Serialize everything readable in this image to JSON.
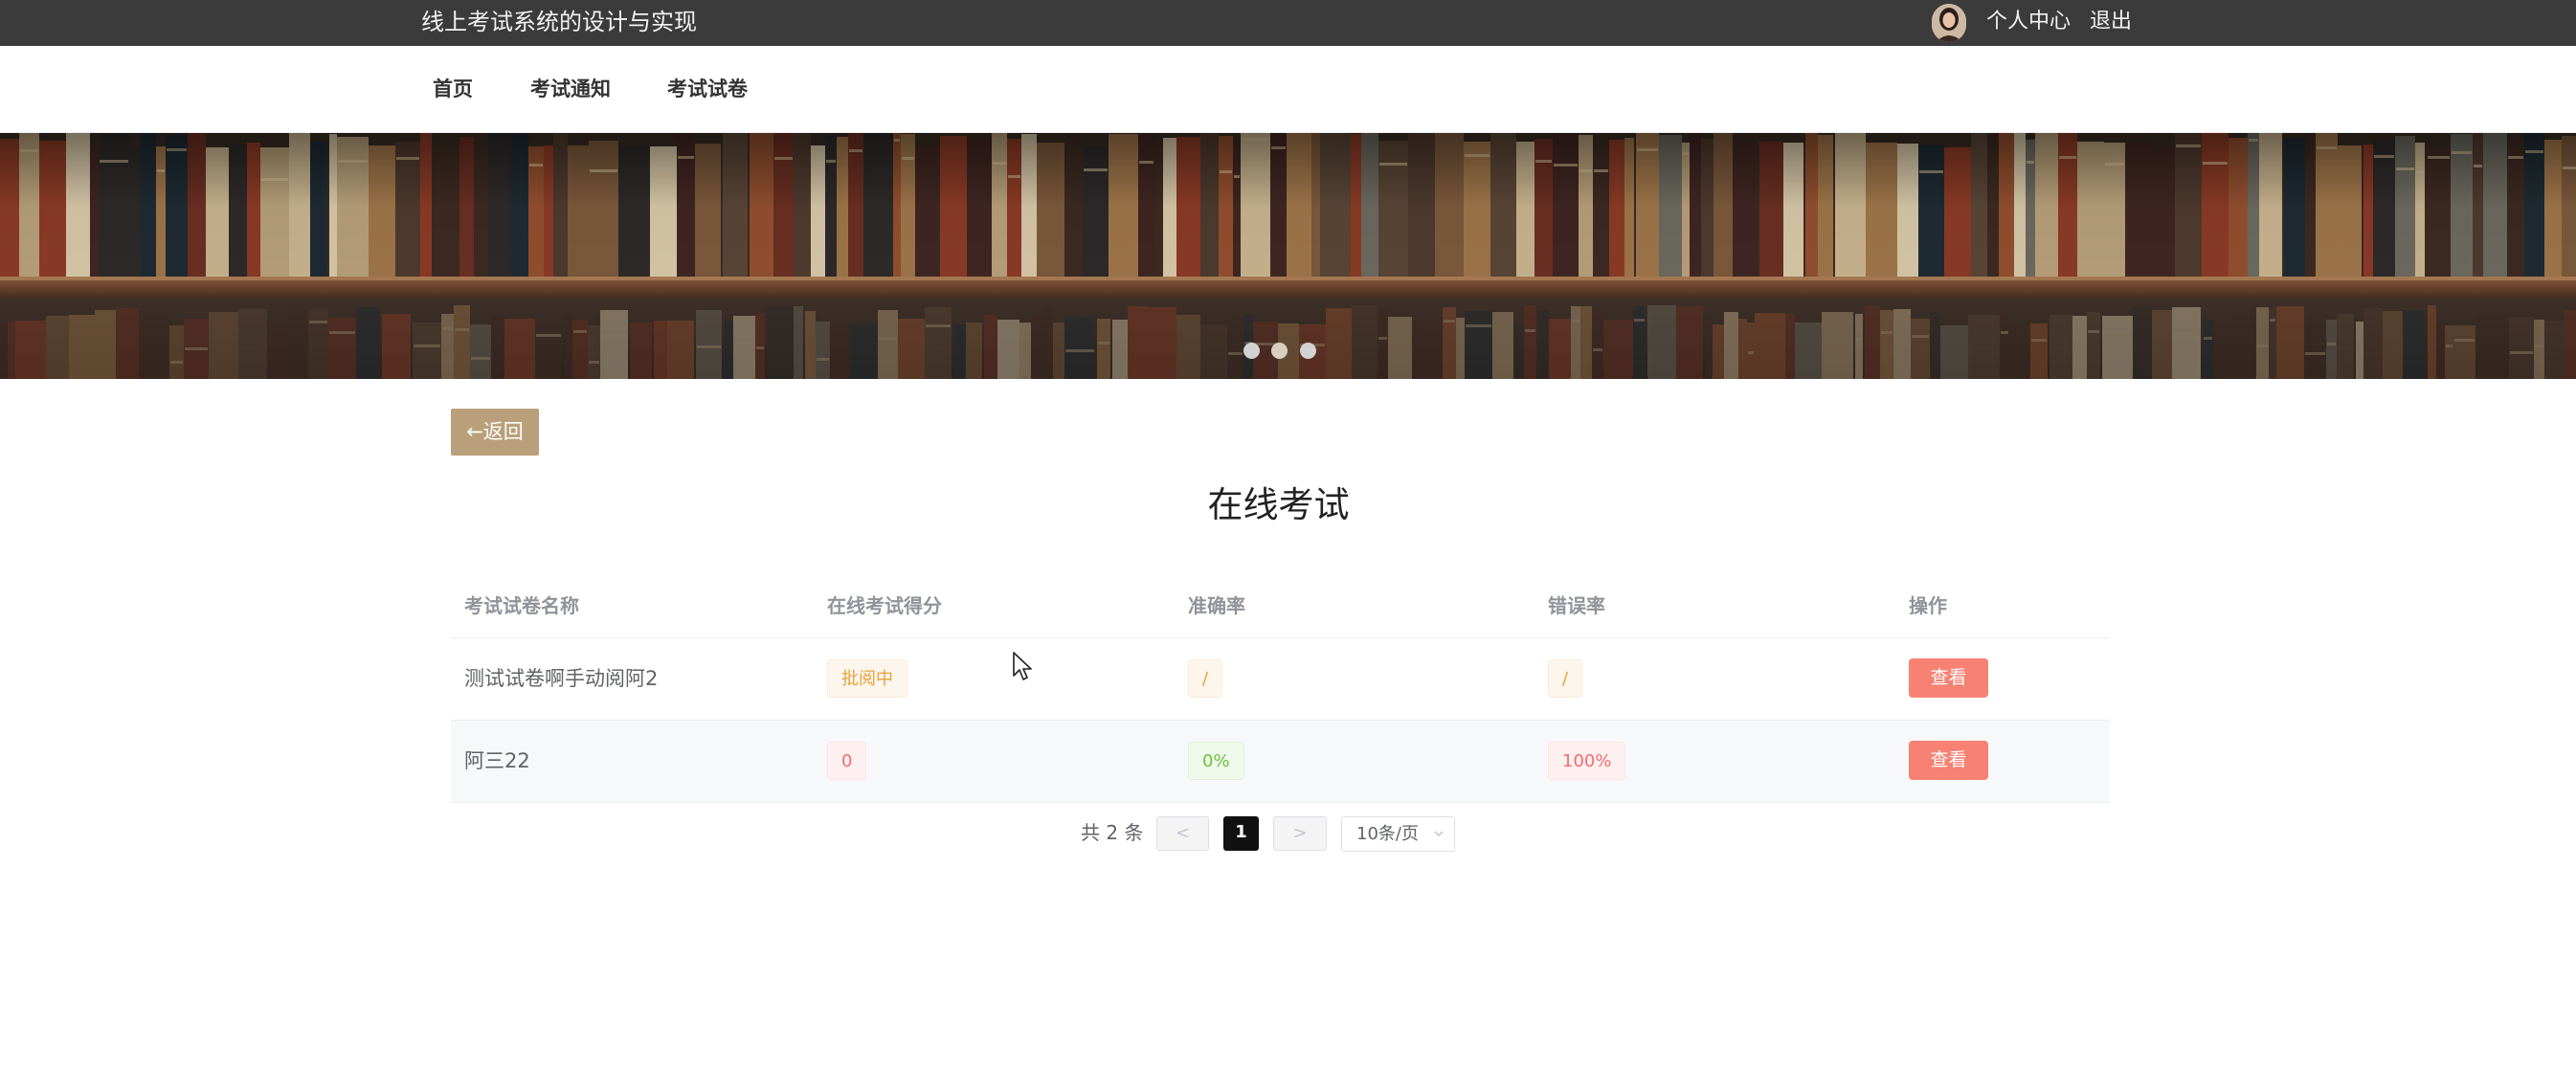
{
  "header": {
    "site_title": "线上考试系统的设计与实现",
    "personal_center": "个人中心",
    "logout": "退出"
  },
  "nav": {
    "items": [
      {
        "label": "首页"
      },
      {
        "label": "考试通知"
      },
      {
        "label": "考试试卷"
      }
    ]
  },
  "banner": {
    "active_slide": 2,
    "slide_count": 3
  },
  "back_button": {
    "label": "←返回"
  },
  "page": {
    "title": "在线考试"
  },
  "table": {
    "columns": [
      "考试试卷名称",
      "在线考试得分",
      "准确率",
      "错误率",
      "操作"
    ],
    "rows": [
      {
        "name": "测试试卷啊手动阅阿2",
        "score": "批阅中",
        "accuracy": "/",
        "error_rate": "/",
        "action": "查看"
      },
      {
        "name": "阿三22",
        "score": "0",
        "accuracy": "0%",
        "error_rate": "100%",
        "action": "查看"
      }
    ]
  },
  "pagination": {
    "total_text": "共 2 条",
    "prev": "<",
    "current_page": "1",
    "next": ">",
    "page_size": "10条/页"
  },
  "colors": {
    "topbar": "#3a3b3a",
    "accent_brown": "#b9a07a",
    "view_button": "#f78173",
    "tag_warning": "#e6a23c",
    "tag_danger": "#f56c6c",
    "tag_success": "#67c23a"
  }
}
